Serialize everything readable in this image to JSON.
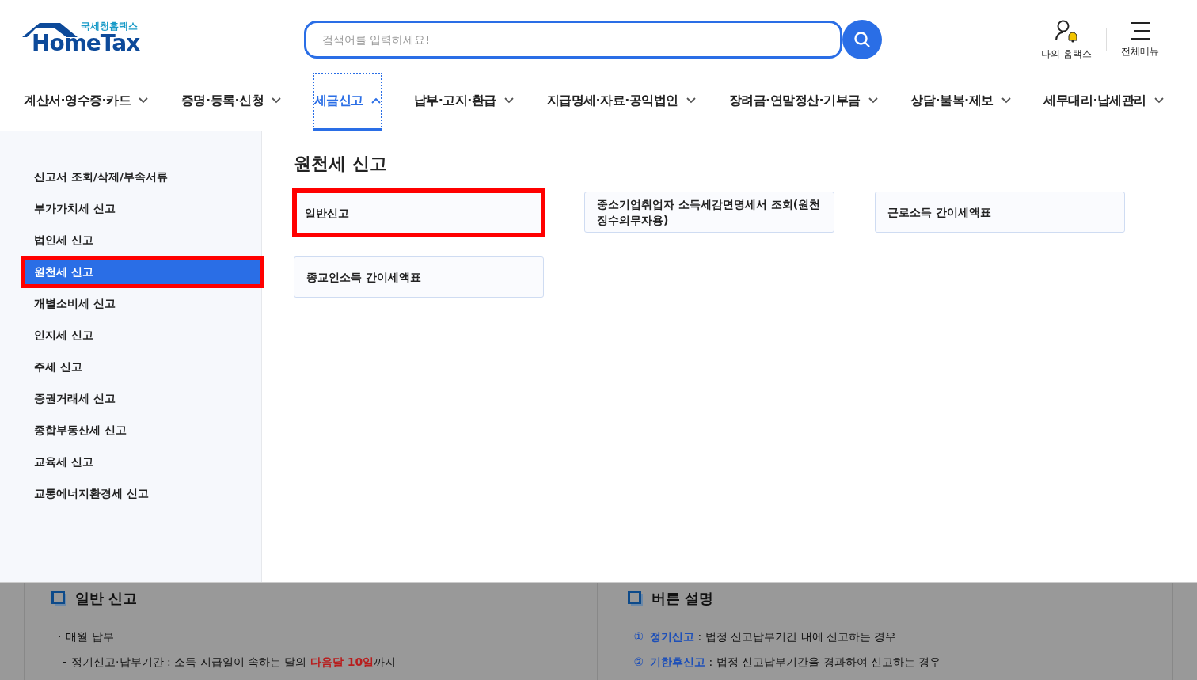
{
  "logo": {
    "subtitle": "국세청홈택스",
    "title": "HomeTax"
  },
  "search": {
    "placeholder": "검색어를 입력하세요!"
  },
  "utility": [
    {
      "kind": "user",
      "label": "나의 홈택스"
    },
    {
      "kind": "menu",
      "label": "전체메뉴"
    }
  ],
  "nav": [
    {
      "label": "계산서·영수증·카드",
      "selected": false
    },
    {
      "label": "증명·등록·신청",
      "selected": false
    },
    {
      "label": "세금신고",
      "selected": true
    },
    {
      "label": "납부·고지·환급",
      "selected": false
    },
    {
      "label": "지급명세·자료·공익법인",
      "selected": false
    },
    {
      "label": "장려금·연말정산·기부금",
      "selected": false
    },
    {
      "label": "상담·불복·제보",
      "selected": false
    },
    {
      "label": "세무대리·납세관리",
      "selected": false
    }
  ],
  "sidebar": {
    "items": [
      {
        "label": "신고서 조회/삭제/부속서류",
        "selected": false
      },
      {
        "label": "부가가치세 신고",
        "selected": false
      },
      {
        "label": "법인세 신고",
        "selected": false
      },
      {
        "label": "원천세 신고",
        "selected": true
      },
      {
        "label": "개별소비세 신고",
        "selected": false
      },
      {
        "label": "인지세 신고",
        "selected": false
      },
      {
        "label": "주세 신고",
        "selected": false
      },
      {
        "label": "증권거래세 신고",
        "selected": false
      },
      {
        "label": "종합부동산세 신고",
        "selected": false
      },
      {
        "label": "교육세 신고",
        "selected": false
      },
      {
        "label": "교통에너지환경세 신고",
        "selected": false
      }
    ]
  },
  "content": {
    "title": "원천세 신고",
    "cards": [
      {
        "label": "일반신고",
        "highlighted": true
      },
      {
        "label": "중소기업취업자 소득세감면명세서 조회(원천징수의무자용)",
        "highlighted": false
      },
      {
        "label": "근로소득 간이세액표",
        "highlighted": false
      },
      {
        "label": "종교인소득 간이세액표",
        "highlighted": false
      }
    ]
  },
  "guide": [
    {
      "heading": "일반 신고",
      "lines": [
        {
          "kind": "bullet",
          "marker": "·",
          "text": "매월 납부"
        },
        {
          "kind": "dash",
          "marker": "-",
          "text": "정기신고·납부기간 : 소득 지급일이 속하는 달의 **다음달 10일**까지"
        }
      ]
    },
    {
      "heading": "버튼 설명",
      "lines": [
        {
          "kind": "numbered",
          "marker": "①",
          "text": "**정기신고** : 법정 신고납부기간 내에 신고하는 경우"
        },
        {
          "kind": "numbered",
          "marker": "②",
          "text": "**기한후신고** : 법정 신고납부기간을 경과하여 신고하는 경우"
        }
      ]
    }
  ]
}
